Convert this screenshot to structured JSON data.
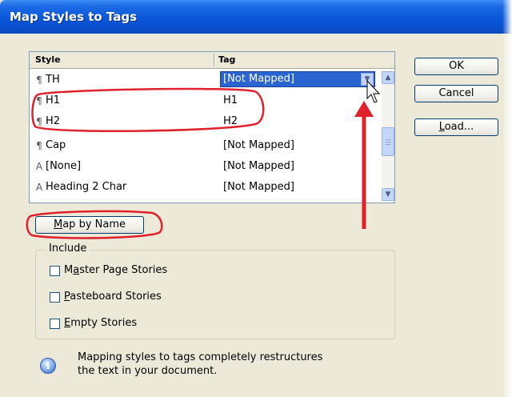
{
  "window": {
    "title": "Map Styles to Tags"
  },
  "list": {
    "headers": {
      "style": "Style",
      "tag": "Tag"
    },
    "rows": [
      {
        "icon": "¶",
        "style": "TH",
        "tag": "[Not Mapped]",
        "selected": true
      },
      {
        "icon": "¶",
        "style": "H1",
        "tag": "H1"
      },
      {
        "icon": "¶",
        "style": "H2",
        "tag": "H2"
      },
      {
        "icon": "¶",
        "style": "Cap",
        "tag": "[Not Mapped]"
      },
      {
        "icon": "A",
        "style": "[None]",
        "tag": "[Not Mapped]"
      },
      {
        "icon": "A",
        "style": "Heading 2 Char",
        "tag": "[Not Mapped]"
      }
    ]
  },
  "buttons": {
    "ok": "OK",
    "cancel": "Cancel",
    "load_u": "L",
    "load_rest": "oad...",
    "map_u": "M",
    "map_rest": "ap by Name"
  },
  "include": {
    "label": "Include",
    "options": [
      {
        "pre": "M",
        "u": "a",
        "post": "ster Page Stories",
        "checked": false
      },
      {
        "pre": "",
        "u": "P",
        "post": "asteboard Stories",
        "checked": false
      },
      {
        "pre": "",
        "u": "E",
        "post": "mpty Stories",
        "checked": false
      }
    ]
  },
  "info": {
    "line1": "Mapping styles to tags completely restructures",
    "line2": "the text in your document."
  },
  "annotation_color": "#e0202a",
  "highlight_color": "#2a64d0"
}
